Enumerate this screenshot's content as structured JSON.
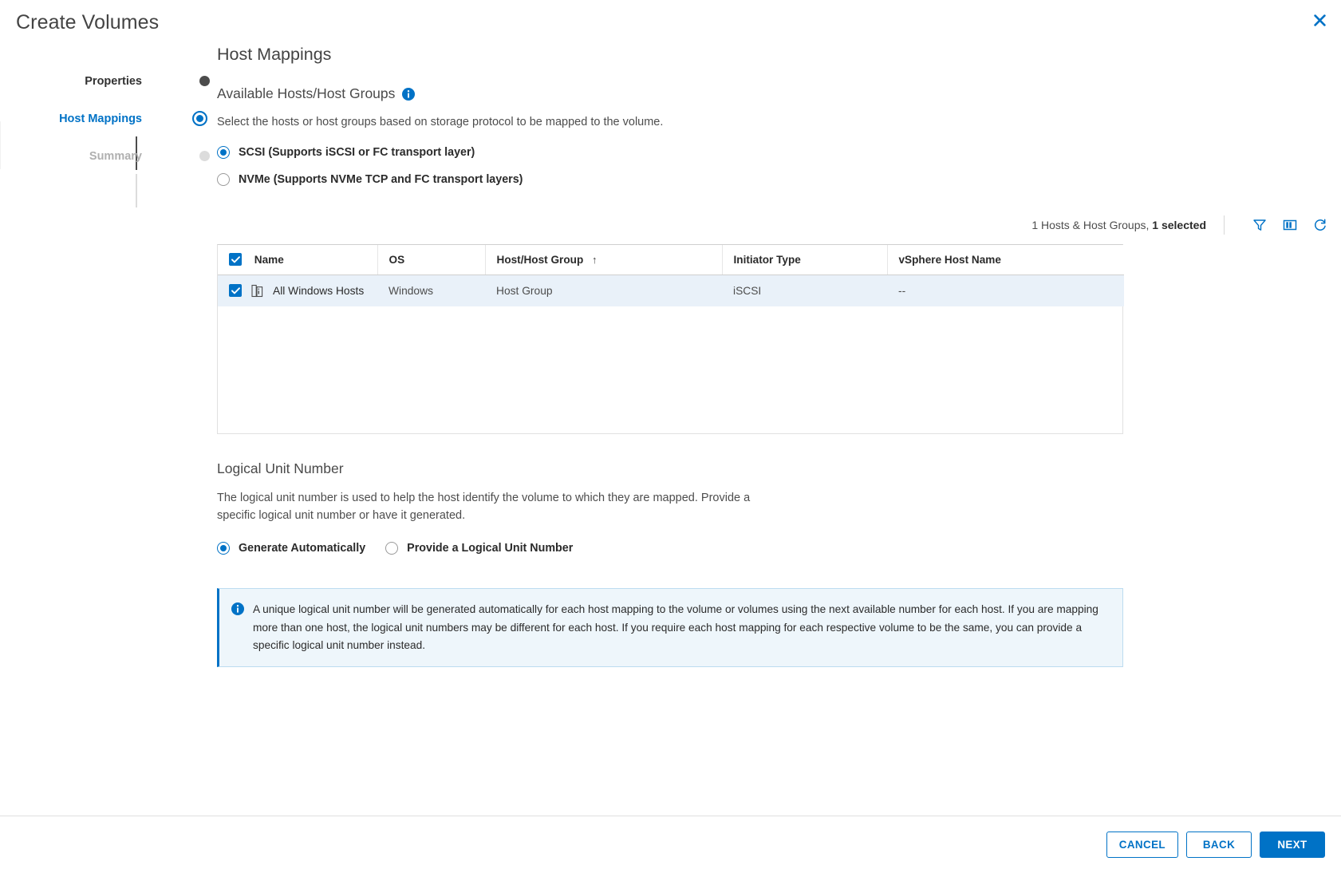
{
  "window": {
    "title": "Create Volumes",
    "close_icon": "close-icon"
  },
  "stepper": {
    "steps": [
      {
        "label": "Properties",
        "state": "done"
      },
      {
        "label": "Host Mappings",
        "state": "active"
      },
      {
        "label": "Summary",
        "state": "todo"
      }
    ]
  },
  "main": {
    "page_title": "Host Mappings",
    "available_hosts": {
      "heading": "Available Hosts/Host Groups",
      "info_icon": "info-icon",
      "helper": "Select the hosts or host groups based on storage protocol to be mapped to the volume.",
      "protocol_options": [
        {
          "label": "SCSI (Supports iSCSI or FC transport layer)",
          "selected": true
        },
        {
          "label": "NVMe (Supports NVMe TCP and FC transport layers)",
          "selected": false
        }
      ]
    },
    "table_toolbar": {
      "count_prefix": "1 Hosts & Host Groups, ",
      "count_selected": "1 selected",
      "icons": [
        {
          "name": "filter-icon",
          "title": "Filter"
        },
        {
          "name": "columns-icon",
          "title": "Show/Hide Columns"
        },
        {
          "name": "refresh-icon",
          "title": "Refresh"
        }
      ]
    },
    "table": {
      "select_all_checked": true,
      "columns": [
        {
          "label": "Name",
          "sorted": false
        },
        {
          "label": "OS",
          "sorted": false
        },
        {
          "label": "Host/Host Group",
          "sorted": true,
          "sort_dir": "↑"
        },
        {
          "label": "Initiator Type",
          "sorted": false
        },
        {
          "label": "vSphere Host Name",
          "sorted": false
        }
      ],
      "rows": [
        {
          "selected": true,
          "icon": "host-group-icon",
          "name": "All Windows Hosts",
          "os": "Windows",
          "host_group": "Host Group",
          "initiator_type": "iSCSI",
          "vsphere_host_name": "--"
        }
      ]
    },
    "lun": {
      "title": "Logical Unit Number",
      "description": "The logical unit number is used to help the host identify the volume to which they are mapped. Provide a specific logical unit number or have it generated.",
      "options": [
        {
          "label": "Generate Automatically",
          "selected": true
        },
        {
          "label": "Provide a Logical Unit Number",
          "selected": false
        }
      ]
    },
    "info_banner": {
      "icon": "info-icon",
      "text": "A unique logical unit number will be generated automatically for each host mapping to the volume or volumes using the next available number for each host. If you are mapping more than one host, the logical unit numbers may be different for each host. If you require each host mapping for each respective volume to be the same, you can provide a specific logical unit number instead."
    }
  },
  "footer": {
    "cancel_label": "CANCEL",
    "back_label": "BACK",
    "next_label": "NEXT"
  },
  "colors": {
    "accent": "#0072c6",
    "row_selected": "#e9f1f9",
    "banner_bg": "#eef6fb"
  }
}
